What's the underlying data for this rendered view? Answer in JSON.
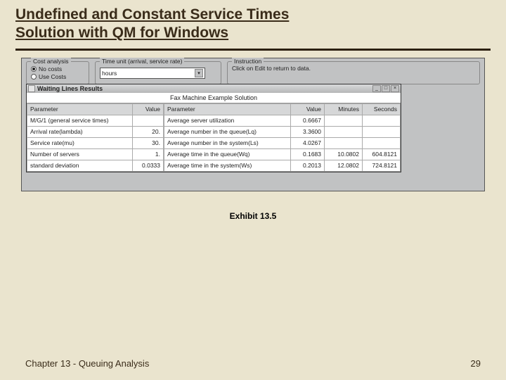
{
  "title_line1": "Undefined and Constant Service Times",
  "title_line2": "Solution with QM for Windows",
  "cost": {
    "legend": "Cost analysis",
    "opt_none": "No costs",
    "opt_use": "Use Costs"
  },
  "timeunit": {
    "legend": "Time unit (arrival, service rate)",
    "value": "hours"
  },
  "instruction": {
    "legend": "Instruction",
    "text": "Click on Edit to return to data."
  },
  "results_title": "Waiting Lines Results",
  "caption": "Fax Machine Example Solution",
  "headers": {
    "parameter": "Parameter",
    "value": "Value",
    "minutes": "Minutes",
    "seconds": "Seconds"
  },
  "left_rows": [
    {
      "p": "M/G/1  (general service times)",
      "v": ""
    },
    {
      "p": "Arrival rate(lambda)",
      "v": "20."
    },
    {
      "p": "Service rate(mu)",
      "v": "30."
    },
    {
      "p": "Number of servers",
      "v": "1."
    },
    {
      "p": "standard deviation",
      "v": "0.0333"
    }
  ],
  "right_rows": [
    {
      "p": "Average server utilization",
      "v": "0.6667",
      "m": "",
      "s": ""
    },
    {
      "p": "Average number in the queue(Lq)",
      "v": "3.3600",
      "m": "",
      "s": ""
    },
    {
      "p": "Average number in the system(Ls)",
      "v": "4.0267",
      "m": "",
      "s": ""
    },
    {
      "p": "Average time in the queue(Wq)",
      "v": "0.1683",
      "m": "10.0802",
      "s": "604.8121"
    },
    {
      "p": "Average time in the system(Ws)",
      "v": "0.2013",
      "m": "12.0802",
      "s": "724.8121"
    }
  ],
  "exhibit": "Exhibit 13.5",
  "footer_left": "Chapter 13 - Queuing Analysis",
  "footer_right": "29"
}
